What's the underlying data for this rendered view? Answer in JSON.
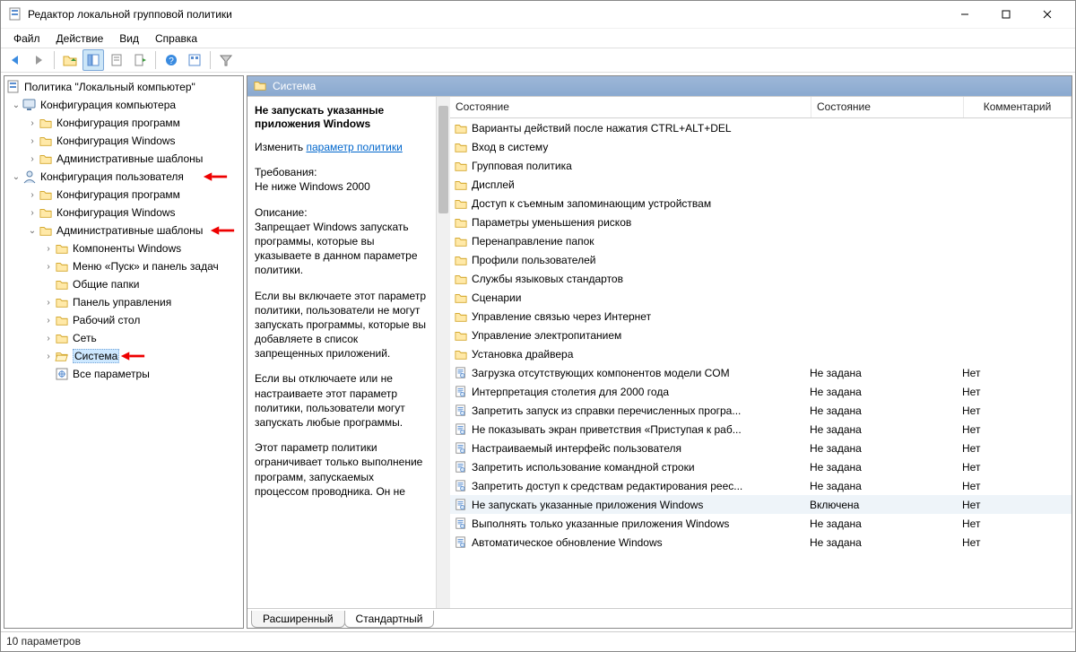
{
  "window": {
    "title": "Редактор локальной групповой политики"
  },
  "menubar": [
    "Файл",
    "Действие",
    "Вид",
    "Справка"
  ],
  "tree": {
    "root": "Политика \"Локальный компьютер\"",
    "computer_config": "Конфигурация компьютера",
    "computer_children": [
      "Конфигурация программ",
      "Конфигурация Windows",
      "Административные шаблоны"
    ],
    "user_config": "Конфигурация пользователя",
    "user_prog": "Конфигурация программ",
    "user_win": "Конфигурация Windows",
    "admin_templates": "Административные шаблоны",
    "adm_children": {
      "comp_win": "Компоненты Windows",
      "start_menu": "Меню «Пуск» и панель задач",
      "shared": "Общие папки",
      "control_panel": "Панель управления",
      "desktop": "Рабочий стол",
      "network": "Сеть",
      "system": "Система",
      "all_settings": "Все параметры"
    }
  },
  "path_header": "Система",
  "description": {
    "title": "Не запускать указанные приложения Windows",
    "edit_prefix": "Изменить ",
    "edit_link": "параметр политики",
    "req_label": "Требования:",
    "req_value": "Не ниже Windows 2000",
    "desc_label": "Описание:",
    "p1": "Запрещает Windows запускать программы, которые вы указываете в данном параметре политики.",
    "p2": "Если вы включаете этот параметр политики, пользователи не могут запускать программы, которые вы добавляете в список запрещенных приложений.",
    "p3": "Если вы отключаете или не настраиваете этот параметр политики, пользователи могут запускать любые программы.",
    "p4": "Этот параметр политики ограничивает только выполнение программ, запускаемых процессом проводника. Он не"
  },
  "columns": {
    "name": "Состояние",
    "state": "Состояние",
    "comment": "Комментарий"
  },
  "folders": [
    "Варианты действий после нажатия CTRL+ALT+DEL",
    "Вход в систему",
    "Групповая политика",
    "Дисплей",
    "Доступ к съемным запоминающим устройствам",
    "Параметры уменьшения рисков",
    "Перенаправление папок",
    "Профили пользователей",
    "Службы языковых стандартов",
    "Сценарии",
    "Управление связью через Интернет",
    "Управление электропитанием",
    "Установка драйвера"
  ],
  "settings": [
    {
      "name": "Загрузка отсутствующих компонентов модели COM",
      "state": "Не задана",
      "comment": "Нет"
    },
    {
      "name": "Интерпретация столетия для 2000 года",
      "state": "Не задана",
      "comment": "Нет"
    },
    {
      "name": "Запретить запуск из справки перечисленных програ...",
      "state": "Не задана",
      "comment": "Нет"
    },
    {
      "name": "Не показывать экран приветствия «Приступая к раб...",
      "state": "Не задана",
      "comment": "Нет"
    },
    {
      "name": "Настраиваемый интерфейс пользователя",
      "state": "Не задана",
      "comment": "Нет"
    },
    {
      "name": "Запретить использование командной строки",
      "state": "Не задана",
      "comment": "Нет"
    },
    {
      "name": "Запретить доступ к средствам редактирования реес...",
      "state": "Не задана",
      "comment": "Нет"
    },
    {
      "name": "Не запускать указанные приложения Windows",
      "state": "Включена",
      "comment": "Нет",
      "selected": true
    },
    {
      "name": "Выполнять только указанные приложения Windows",
      "state": "Не задана",
      "comment": "Нет"
    },
    {
      "name": "Автоматическое обновление Windows",
      "state": "Не задана",
      "comment": "Нет"
    }
  ],
  "tabs": {
    "extended": "Расширенный",
    "standard": "Стандартный"
  },
  "statusbar": "10 параметров"
}
